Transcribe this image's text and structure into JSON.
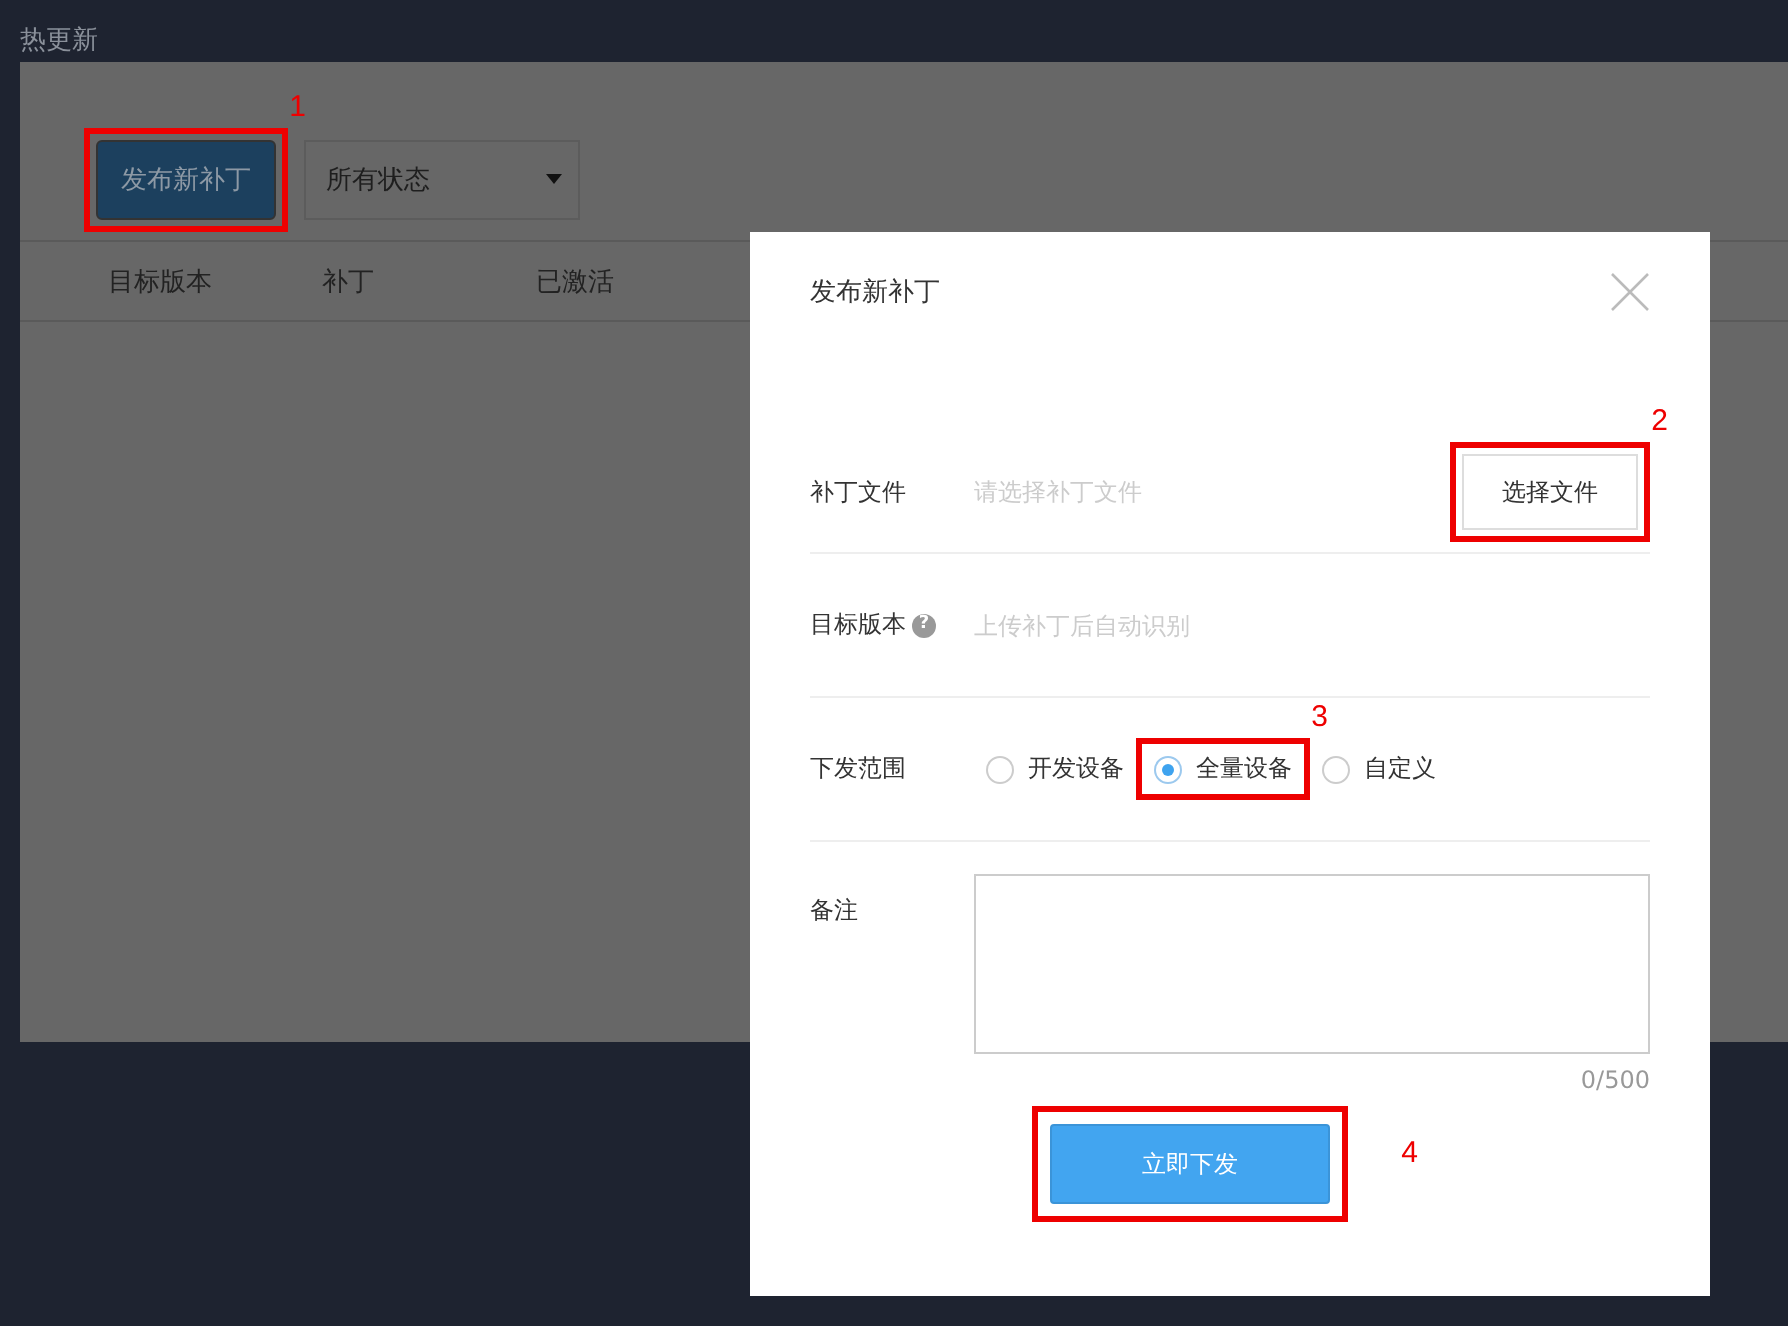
{
  "page_title": "热更新",
  "toolbar": {
    "publish_button": {
      "label": "发布新补丁",
      "callout": "1"
    },
    "status_select": {
      "value": "所有状态"
    }
  },
  "table": {
    "columns": [
      "目标版本",
      "补丁",
      "已激活"
    ]
  },
  "dialog": {
    "title": "发布新补丁",
    "file_row": {
      "label": "补丁文件",
      "placeholder": "请选择补丁文件",
      "button": "选择文件",
      "callout": "2"
    },
    "version_row": {
      "label": "目标版本",
      "help_mark": "?",
      "placeholder": "上传补丁后自动识别"
    },
    "scope_row": {
      "label": "下发范围",
      "callout": "3",
      "options": [
        {
          "label": "开发设备",
          "selected": false
        },
        {
          "label": "全量设备",
          "selected": true
        },
        {
          "label": "自定义",
          "selected": false
        }
      ]
    },
    "note_row": {
      "label": "备注",
      "counter": "0/500"
    },
    "submit": {
      "label": "立即下发",
      "callout": "4"
    }
  }
}
